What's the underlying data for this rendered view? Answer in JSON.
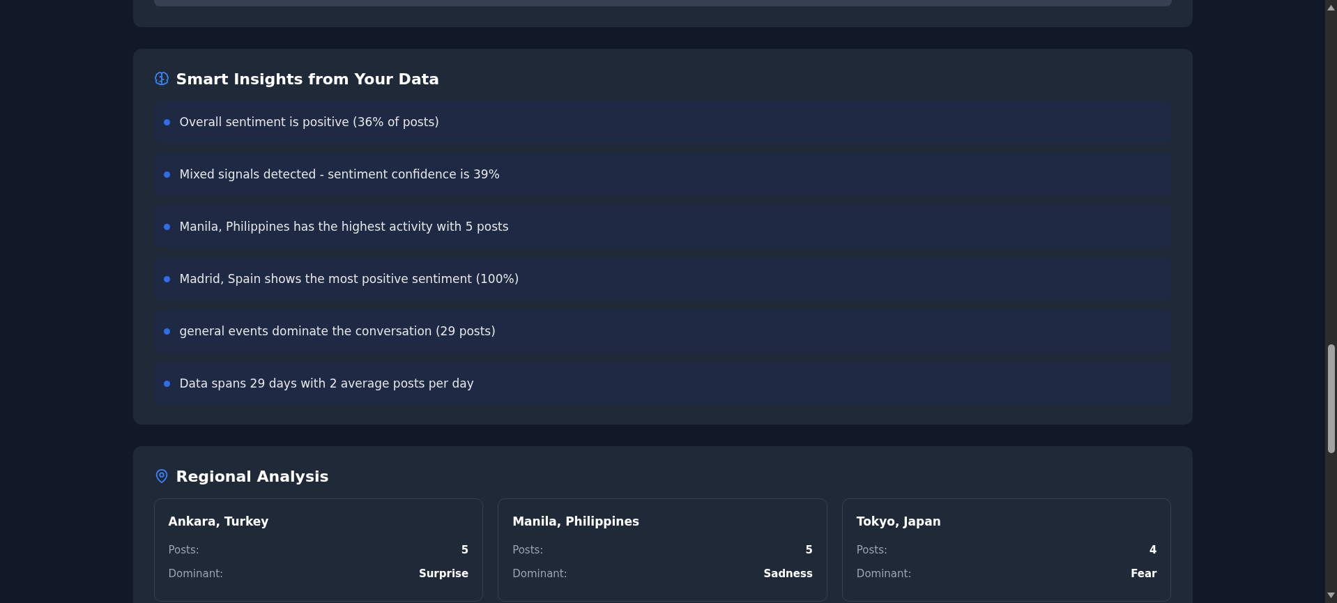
{
  "insights": {
    "title": "Smart Insights from Your Data",
    "items": [
      "Overall sentiment is positive (36% of posts)",
      "Mixed signals detected - sentiment confidence is 39%",
      "Manila, Philippines has the highest activity with 5 posts",
      "Madrid, Spain shows the most positive sentiment (100%)",
      "general events dominate the conversation (29 posts)",
      "Data spans 29 days with 2 average posts per day"
    ]
  },
  "regional": {
    "title": "Regional Analysis",
    "regions": [
      {
        "name": "Ankara, Turkey",
        "stats": [
          {
            "label": "Posts:",
            "value": "5"
          },
          {
            "label": "Dominant:",
            "value": "Surprise"
          }
        ]
      },
      {
        "name": "Manila, Philippines",
        "stats": [
          {
            "label": "Posts:",
            "value": "5"
          },
          {
            "label": "Dominant:",
            "value": "Sadness"
          }
        ]
      },
      {
        "name": "Tokyo, Japan",
        "stats": [
          {
            "label": "Posts:",
            "value": "4"
          },
          {
            "label": "Dominant:",
            "value": "Fear"
          }
        ]
      }
    ]
  }
}
